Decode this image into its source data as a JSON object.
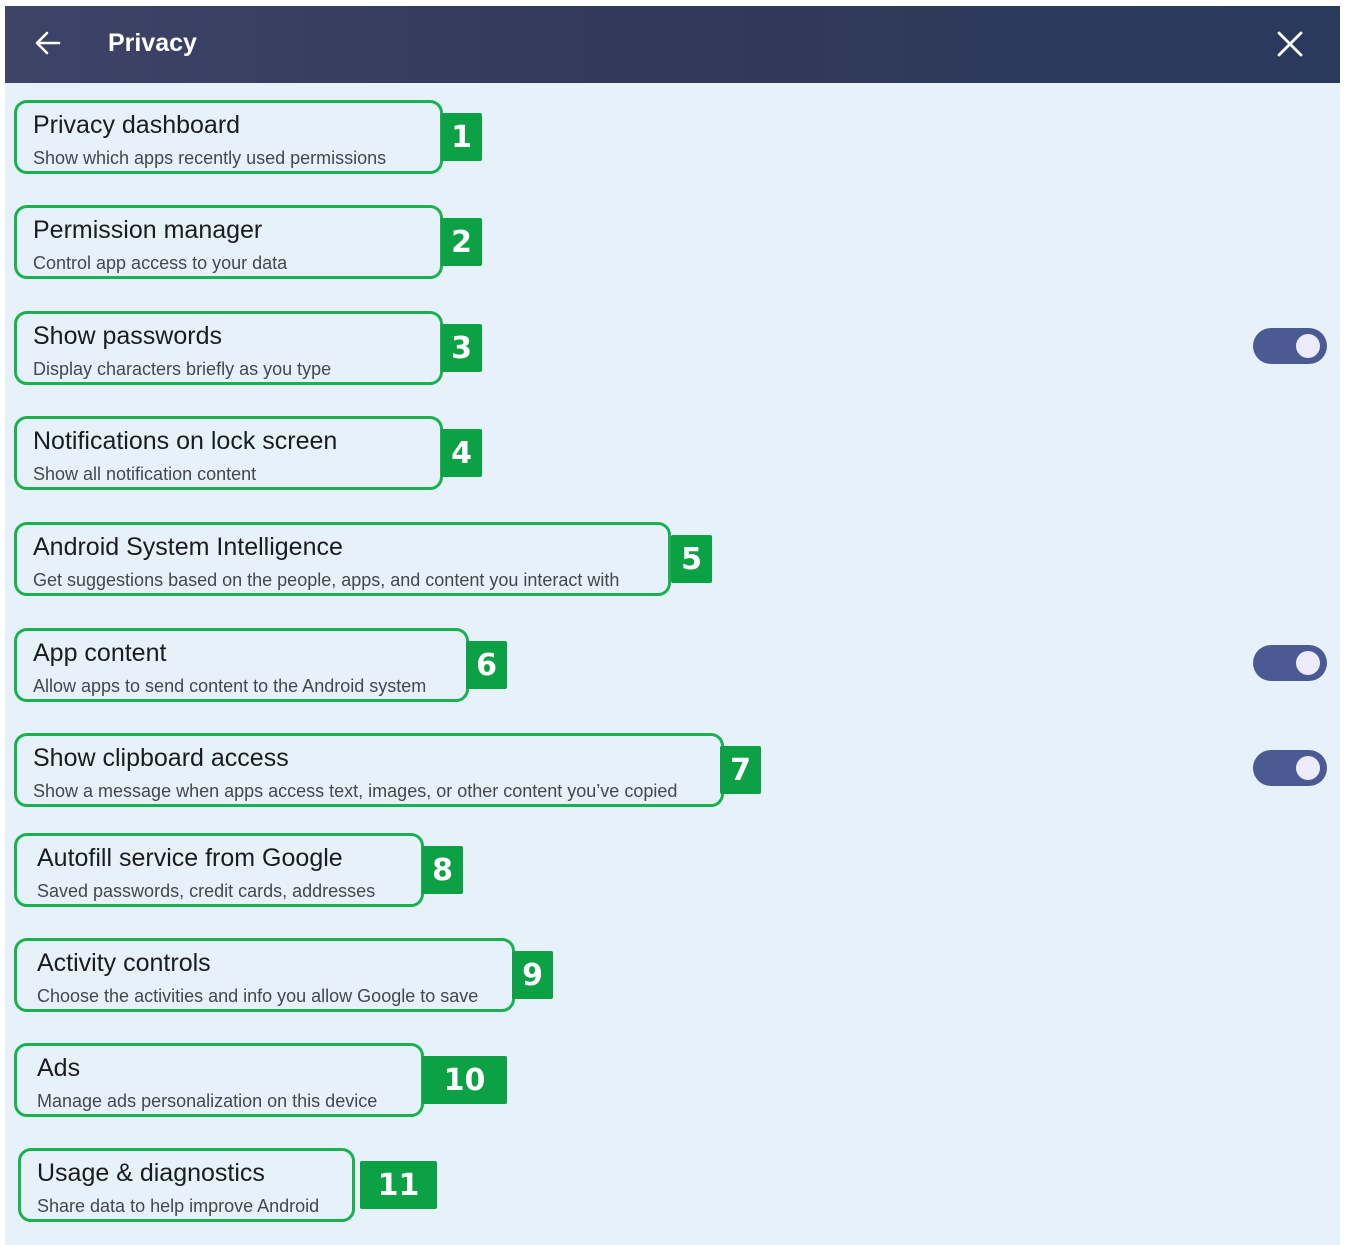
{
  "header": {
    "title": "Privacy",
    "back_icon": "arrow-left-icon",
    "close_icon": "close-icon"
  },
  "colors": {
    "header_bg": "#33395a",
    "panel_bg": "#e6f1fa",
    "highlight": "#19b24e",
    "badge": "#0ca144",
    "toggle_on": "#4c5a93"
  },
  "settings": [
    {
      "number": "1",
      "title": "Privacy dashboard",
      "subtitle": "Show which apps recently used permissions",
      "toggle": null
    },
    {
      "number": "2",
      "title": "Permission manager",
      "subtitle": "Control app access to your data",
      "toggle": null
    },
    {
      "number": "3",
      "title": "Show passwords",
      "subtitle": "Display characters briefly as you type",
      "toggle": "on"
    },
    {
      "number": "4",
      "title": "Notifications on lock screen",
      "subtitle": "Show all notification content",
      "toggle": null
    },
    {
      "number": "5",
      "title": "Android System Intelligence",
      "subtitle": "Get suggestions based on the people, apps, and content you interact with",
      "toggle": null
    },
    {
      "number": "6",
      "title": "App content",
      "subtitle": "Allow apps to send content to the Android system",
      "toggle": "on"
    },
    {
      "number": "7",
      "title": "Show clipboard access",
      "subtitle": "Show a message when apps access text, images, or other content you’ve copied",
      "toggle": "on"
    },
    {
      "number": "8",
      "title": "Autofill service from Google",
      "subtitle": "Saved passwords, credit cards, addresses",
      "toggle": null
    },
    {
      "number": "9",
      "title": "Activity controls",
      "subtitle": "Choose the activities and info you allow Google to save",
      "toggle": null
    },
    {
      "number": "10",
      "title": "Ads",
      "subtitle": "Manage ads personalization on this device",
      "toggle": null
    },
    {
      "number": "11",
      "title": "Usage & diagnostics",
      "subtitle": "Share data to help improve Android",
      "toggle": null
    }
  ]
}
